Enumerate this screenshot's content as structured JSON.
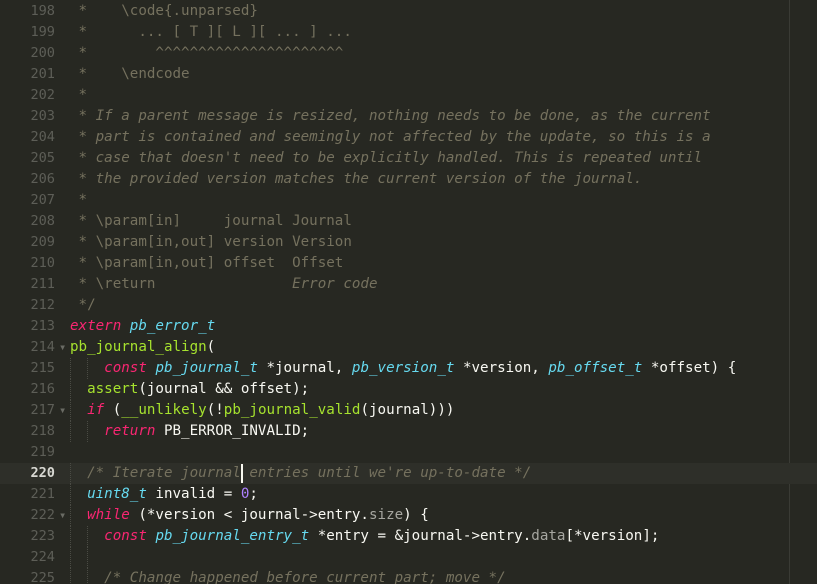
{
  "colors": {
    "background": "#272822",
    "comment": "#75715e",
    "keyword": "#f92672",
    "type": "#66d9ef",
    "function": "#a6e22e",
    "number": "#ae81ff",
    "text": "#f8f8f2"
  },
  "current_line": "220",
  "lines": [
    {
      "n": "198",
      "tokens": [
        {
          "c": "comment",
          "t": " *    \\code{.unparsed}"
        }
      ]
    },
    {
      "n": "199",
      "tokens": [
        {
          "c": "comment",
          "t": " *      ... [ T ][ L ][ ... ] ..."
        }
      ]
    },
    {
      "n": "200",
      "tokens": [
        {
          "c": "comment",
          "t": " *        ^^^^^^^^^^^^^^^^^^^^^^"
        }
      ]
    },
    {
      "n": "201",
      "tokens": [
        {
          "c": "comment",
          "t": " *    \\endcode"
        }
      ]
    },
    {
      "n": "202",
      "tokens": [
        {
          "c": "comment",
          "t": " *"
        }
      ]
    },
    {
      "n": "203",
      "tokens": [
        {
          "c": "comment",
          "t": " * "
        },
        {
          "c": "comment doc",
          "t": "If a parent message is resized, nothing needs to be done, as the current"
        }
      ]
    },
    {
      "n": "204",
      "tokens": [
        {
          "c": "comment",
          "t": " * "
        },
        {
          "c": "comment doc",
          "t": "part is contained and seemingly not affected by the update, so this is a"
        }
      ]
    },
    {
      "n": "205",
      "tokens": [
        {
          "c": "comment",
          "t": " * "
        },
        {
          "c": "comment doc",
          "t": "case that doesn't need to be explicitly handled. This is repeated until"
        }
      ]
    },
    {
      "n": "206",
      "tokens": [
        {
          "c": "comment",
          "t": " * "
        },
        {
          "c": "comment doc",
          "t": "the provided version matches the current version of the journal."
        }
      ]
    },
    {
      "n": "207",
      "tokens": [
        {
          "c": "comment",
          "t": " *"
        }
      ]
    },
    {
      "n": "208",
      "tokens": [
        {
          "c": "comment",
          "t": " * \\param[in]     journal Journal"
        }
      ]
    },
    {
      "n": "209",
      "tokens": [
        {
          "c": "comment",
          "t": " * \\param[in,out] version Version"
        }
      ]
    },
    {
      "n": "210",
      "tokens": [
        {
          "c": "comment",
          "t": " * \\param[in,out] offset  Offset"
        }
      ]
    },
    {
      "n": "211",
      "tokens": [
        {
          "c": "comment",
          "t": " * \\return                "
        },
        {
          "c": "comment doc",
          "t": "Error code"
        }
      ]
    },
    {
      "n": "212",
      "tokens": [
        {
          "c": "comment",
          "t": " */"
        }
      ]
    },
    {
      "n": "213",
      "tokens": [
        {
          "c": "keyword",
          "t": "extern"
        },
        {
          "c": "plain",
          "t": " "
        },
        {
          "c": "type",
          "t": "pb_error_t"
        }
      ]
    },
    {
      "n": "214",
      "fold": "▾",
      "tokens": [
        {
          "c": "func",
          "t": "pb_journal_align"
        },
        {
          "c": "plain",
          "t": "("
        }
      ]
    },
    {
      "n": "215",
      "tokens": [
        {
          "c": "plain",
          "t": "    "
        },
        {
          "c": "keyword",
          "t": "const"
        },
        {
          "c": "plain",
          "t": " "
        },
        {
          "c": "type",
          "t": "pb_journal_t"
        },
        {
          "c": "plain",
          "t": " *journal, "
        },
        {
          "c": "type",
          "t": "pb_version_t"
        },
        {
          "c": "plain",
          "t": " *version, "
        },
        {
          "c": "type",
          "t": "pb_offset_t"
        },
        {
          "c": "plain",
          "t": " *offset) {"
        }
      ]
    },
    {
      "n": "216",
      "tokens": [
        {
          "c": "plain",
          "t": "  "
        },
        {
          "c": "func",
          "t": "assert"
        },
        {
          "c": "plain",
          "t": "(journal && offset);"
        }
      ]
    },
    {
      "n": "217",
      "fold": "▾",
      "tokens": [
        {
          "c": "plain",
          "t": "  "
        },
        {
          "c": "keyword",
          "t": "if"
        },
        {
          "c": "plain",
          "t": " ("
        },
        {
          "c": "func",
          "t": "__unlikely"
        },
        {
          "c": "plain",
          "t": "(!"
        },
        {
          "c": "func",
          "t": "pb_journal_valid"
        },
        {
          "c": "plain",
          "t": "(journal)))"
        }
      ]
    },
    {
      "n": "218",
      "tokens": [
        {
          "c": "plain",
          "t": "    "
        },
        {
          "c": "keyword",
          "t": "return"
        },
        {
          "c": "plain",
          "t": " PB_ERROR_INVALID;"
        }
      ]
    },
    {
      "n": "219",
      "tokens": []
    },
    {
      "n": "220",
      "tokens": [
        {
          "c": "plain",
          "t": "  "
        },
        {
          "c": "comment doc",
          "t": "/* Iterate journal entries until we're up-to-date */"
        }
      ]
    },
    {
      "n": "221",
      "tokens": [
        {
          "c": "plain",
          "t": "  "
        },
        {
          "c": "type",
          "t": "uint8_t"
        },
        {
          "c": "plain",
          "t": " invalid = "
        },
        {
          "c": "number",
          "t": "0"
        },
        {
          "c": "plain",
          "t": ";"
        }
      ]
    },
    {
      "n": "222",
      "fold": "▾",
      "tokens": [
        {
          "c": "plain",
          "t": "  "
        },
        {
          "c": "keyword",
          "t": "while"
        },
        {
          "c": "plain",
          "t": " (*version < journal->entry."
        },
        {
          "c": "member",
          "t": "size"
        },
        {
          "c": "plain",
          "t": ") {"
        }
      ]
    },
    {
      "n": "223",
      "tokens": [
        {
          "c": "plain",
          "t": "    "
        },
        {
          "c": "keyword",
          "t": "const"
        },
        {
          "c": "plain",
          "t": " "
        },
        {
          "c": "type",
          "t": "pb_journal_entry_t"
        },
        {
          "c": "plain",
          "t": " *entry = &journal->entry."
        },
        {
          "c": "member",
          "t": "data"
        },
        {
          "c": "plain",
          "t": "[*version];"
        }
      ]
    },
    {
      "n": "224",
      "tokens": []
    },
    {
      "n": "225",
      "tokens": [
        {
          "c": "plain",
          "t": "    "
        },
        {
          "c": "comment doc",
          "t": "/* Change happened before current part; move */"
        }
      ]
    }
  ]
}
